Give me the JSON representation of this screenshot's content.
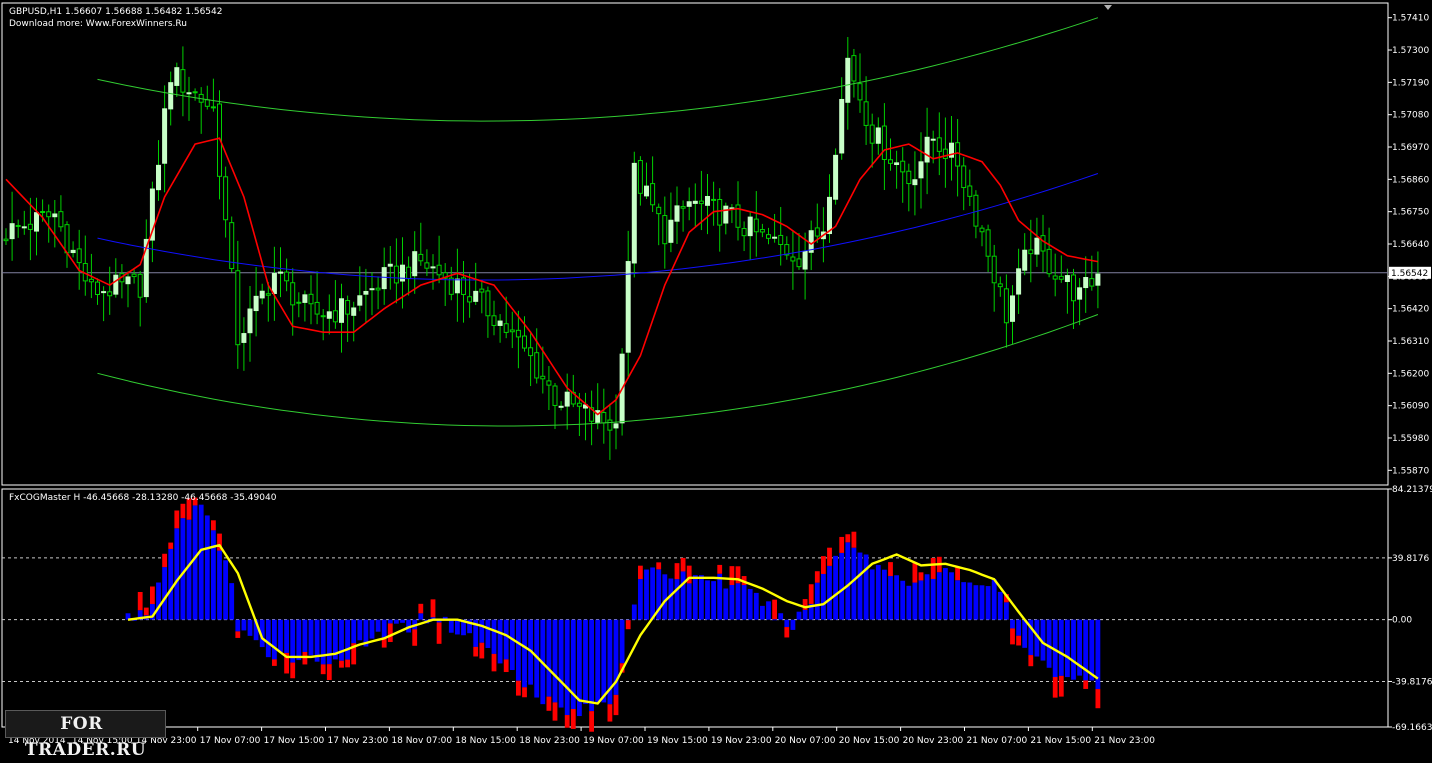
{
  "window": {
    "price_title": "GBPUSD,H1  1.56607 1.56688 1.56482 1.56542",
    "price_sub": "Download more: Www.ForexWinners.Ru",
    "indicator_title": "FxCOGMaster H -46.45668 -28.13280 -46.45668 -35.49040",
    "watermark_left": "FOR",
    "watermark_right": "TRADER.RU"
  },
  "colors": {
    "background": "#000000",
    "frame": "#ffffff",
    "bull_candle": "#c8ffc8",
    "wick": "#00d000",
    "red_line": "#ff0000",
    "green_band": "#32cd32",
    "blue_line": "#1010ff",
    "hist_blue": "#0000ff",
    "hist_red": "#ff0000",
    "yellow_line": "#ffff00",
    "grid_dash": "#c8c8c8"
  },
  "chart_data": [
    {
      "type": "candlestick",
      "symbol": "GBPUSD",
      "timeframe": "H1",
      "ylim": [
        1.5582,
        1.5746
      ],
      "yticks": [
        "1.57410",
        "1.57300",
        "1.57190",
        "1.57080",
        "1.56970",
        "1.56860",
        "1.56750",
        "1.56640",
        "1.56530",
        "1.56420",
        "1.56310",
        "1.56200",
        "1.56090",
        "1.55980",
        "1.55870"
      ],
      "current_price_label": "1.56542",
      "current_price": 1.56542,
      "x_labels": [
        "14 Nov 2014",
        "14 Nov 15:00",
        "14 Nov 23:00",
        "17 Nov 07:00",
        "17 Nov 15:00",
        "17 Nov 23:00",
        "18 Nov 07:00",
        "18 Nov 15:00",
        "18 Nov 23:00",
        "19 Nov 07:00",
        "19 Nov 15:00",
        "19 Nov 23:00",
        "20 Nov 07:00",
        "20 Nov 15:00",
        "20 Nov 23:00",
        "21 Nov 07:00",
        "21 Nov 15:00",
        "21 Nov 23:00"
      ],
      "bar_count": 180,
      "close_keypoints": [
        [
          0,
          1.5668
        ],
        [
          8,
          1.5674
        ],
        [
          14,
          1.5648
        ],
        [
          22,
          1.565
        ],
        [
          27,
          1.5722
        ],
        [
          34,
          1.571
        ],
        [
          38,
          1.5632
        ],
        [
          44,
          1.5654
        ],
        [
          50,
          1.564
        ],
        [
          56,
          1.5642
        ],
        [
          62,
          1.5652
        ],
        [
          68,
          1.5658
        ],
        [
          74,
          1.565
        ],
        [
          80,
          1.564
        ],
        [
          86,
          1.5625
        ],
        [
          90,
          1.5612
        ],
        [
          96,
          1.5605
        ],
        [
          100,
          1.5602
        ],
        [
          103,
          1.5688
        ],
        [
          108,
          1.5668
        ],
        [
          112,
          1.5678
        ],
        [
          118,
          1.5674
        ],
        [
          124,
          1.5666
        ],
        [
          130,
          1.566
        ],
        [
          134,
          1.567
        ],
        [
          138,
          1.5727
        ],
        [
          142,
          1.5702
        ],
        [
          148,
          1.5686
        ],
        [
          152,
          1.57
        ],
        [
          156,
          1.5692
        ],
        [
          160,
          1.5668
        ],
        [
          164,
          1.564
        ],
        [
          168,
          1.5664
        ],
        [
          172,
          1.5655
        ],
        [
          176,
          1.5646
        ],
        [
          179,
          1.5654
        ]
      ],
      "red_ma_keypoints": [
        [
          0,
          1.5686
        ],
        [
          6,
          1.5673
        ],
        [
          12,
          1.5655
        ],
        [
          17,
          1.565
        ],
        [
          22,
          1.5657
        ],
        [
          26,
          1.568
        ],
        [
          31,
          1.5698
        ],
        [
          35,
          1.57
        ],
        [
          39,
          1.568
        ],
        [
          43,
          1.565
        ],
        [
          47,
          1.5636
        ],
        [
          52,
          1.5634
        ],
        [
          57,
          1.5634
        ],
        [
          62,
          1.5642
        ],
        [
          68,
          1.565
        ],
        [
          74,
          1.5654
        ],
        [
          80,
          1.565
        ],
        [
          86,
          1.5634
        ],
        [
          92,
          1.5615
        ],
        [
          97,
          1.5606
        ],
        [
          100,
          1.5611
        ],
        [
          104,
          1.5626
        ],
        [
          108,
          1.565
        ],
        [
          112,
          1.5668
        ],
        [
          116,
          1.5675
        ],
        [
          120,
          1.5676
        ],
        [
          124,
          1.5674
        ],
        [
          128,
          1.567
        ],
        [
          132,
          1.5664
        ],
        [
          136,
          1.567
        ],
        [
          140,
          1.5686
        ],
        [
          144,
          1.5696
        ],
        [
          148,
          1.5698
        ],
        [
          152,
          1.5693
        ],
        [
          156,
          1.5695
        ],
        [
          160,
          1.5692
        ],
        [
          163,
          1.5684
        ],
        [
          166,
          1.5672
        ],
        [
          170,
          1.5665
        ],
        [
          174,
          1.566
        ],
        [
          179,
          1.5658
        ]
      ],
      "blue_line": {
        "start_bar": 15,
        "end_bar": 179,
        "start": 1.5666,
        "mid": 1.5653,
        "end": 1.5688
      },
      "upper_band": {
        "start_bar": 15,
        "end_bar": 179,
        "start": 1.572,
        "mid": 1.5707,
        "end": 1.5741
      },
      "lower_band": {
        "start_bar": 15,
        "end_bar": 179,
        "start": 1.562,
        "mid": 1.5603,
        "end": 1.564
      }
    },
    {
      "type": "histogram",
      "name": "FxCOGMaster H",
      "ylim": [
        -69.1663,
        84.21379
      ],
      "yticks": [
        "84.21379",
        "39.8176",
        "0.00",
        "-39.8176",
        "-69.1663"
      ],
      "levels": [
        39.8176,
        0,
        -39.8176
      ],
      "start_bar": 20,
      "end_bar": 179,
      "hist_keypoints": [
        [
          20,
          0
        ],
        [
          24,
          10
        ],
        [
          28,
          55
        ],
        [
          31,
          75
        ],
        [
          34,
          60
        ],
        [
          37,
          25
        ],
        [
          38,
          -8
        ],
        [
          42,
          -20
        ],
        [
          46,
          -22
        ],
        [
          50,
          -25
        ],
        [
          54,
          -26
        ],
        [
          58,
          -18
        ],
        [
          62,
          -8
        ],
        [
          66,
          -4
        ],
        [
          70,
          4
        ],
        [
          72,
          -2
        ],
        [
          76,
          -12
        ],
        [
          80,
          -22
        ],
        [
          84,
          -35
        ],
        [
          88,
          -50
        ],
        [
          92,
          -60
        ],
        [
          96,
          -58
        ],
        [
          100,
          -48
        ],
        [
          102,
          0
        ],
        [
          104,
          28
        ],
        [
          108,
          30
        ],
        [
          112,
          27
        ],
        [
          116,
          28
        ],
        [
          120,
          20
        ],
        [
          124,
          12
        ],
        [
          128,
          -5
        ],
        [
          131,
          5
        ],
        [
          134,
          30
        ],
        [
          138,
          52
        ],
        [
          142,
          36
        ],
        [
          146,
          28
        ],
        [
          150,
          25
        ],
        [
          154,
          30
        ],
        [
          158,
          25
        ],
        [
          162,
          22
        ],
        [
          164,
          10
        ],
        [
          166,
          -15
        ],
        [
          170,
          -30
        ],
        [
          174,
          -35
        ],
        [
          178,
          -42
        ],
        [
          179,
          -40
        ]
      ],
      "signal_keypoints": [
        [
          20,
          0
        ],
        [
          24,
          2
        ],
        [
          28,
          25
        ],
        [
          32,
          45
        ],
        [
          35,
          48
        ],
        [
          38,
          30
        ],
        [
          42,
          -12
        ],
        [
          46,
          -24
        ],
        [
          50,
          -24
        ],
        [
          54,
          -22
        ],
        [
          58,
          -16
        ],
        [
          62,
          -12
        ],
        [
          66,
          -5
        ],
        [
          70,
          0
        ],
        [
          74,
          0
        ],
        [
          78,
          -4
        ],
        [
          82,
          -10
        ],
        [
          86,
          -20
        ],
        [
          90,
          -36
        ],
        [
          94,
          -52
        ],
        [
          97,
          -54
        ],
        [
          100,
          -40
        ],
        [
          104,
          -10
        ],
        [
          108,
          12
        ],
        [
          112,
          27
        ],
        [
          116,
          27
        ],
        [
          120,
          26
        ],
        [
          124,
          20
        ],
        [
          128,
          12
        ],
        [
          131,
          8
        ],
        [
          134,
          10
        ],
        [
          138,
          22
        ],
        [
          142,
          36
        ],
        [
          146,
          42
        ],
        [
          150,
          35
        ],
        [
          154,
          36
        ],
        [
          158,
          32
        ],
        [
          162,
          26
        ],
        [
          166,
          5
        ],
        [
          170,
          -15
        ],
        [
          174,
          -24
        ],
        [
          179,
          -38
        ]
      ]
    }
  ]
}
